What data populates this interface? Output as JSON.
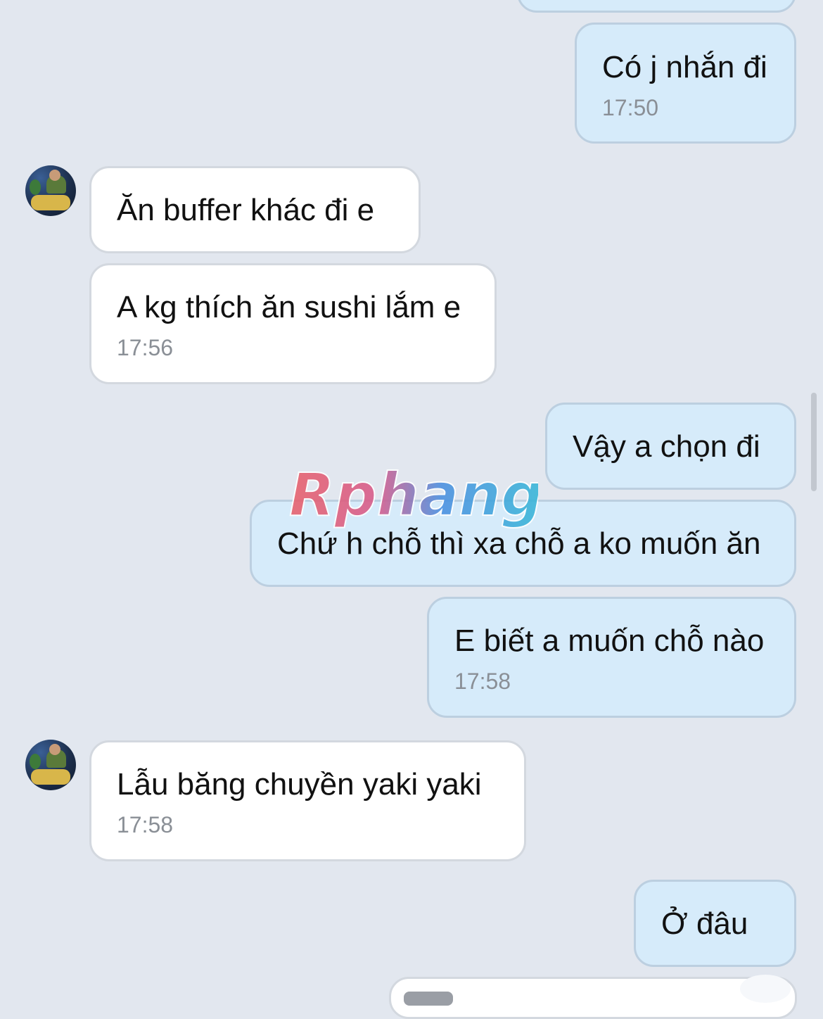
{
  "colors": {
    "background": "#e2e7ef",
    "outgoing_bubble": "#d6ebfa",
    "incoming_bubble": "#ffffff",
    "timestamp": "#8a8f96"
  },
  "messages": [
    {
      "direction": "outgoing",
      "text": "Có j nhắn đi",
      "time": "17:50"
    },
    {
      "direction": "incoming",
      "text": "Ăn buffer khác đi e",
      "time": ""
    },
    {
      "direction": "incoming",
      "text": "A kg thích ăn sushi lắm e",
      "time": "17:56"
    },
    {
      "direction": "outgoing",
      "text": "Vậy a chọn đi",
      "time": ""
    },
    {
      "direction": "outgoing",
      "text": "Chứ h chỗ thì xa chỗ a ko muốn ăn",
      "time": ""
    },
    {
      "direction": "outgoing",
      "text": "E biết a muốn chỗ nào",
      "time": "17:58"
    },
    {
      "direction": "incoming",
      "text": "Lẫu băng chuyền yaki yaki",
      "time": "17:58"
    },
    {
      "direction": "outgoing",
      "text": "Ở đâu",
      "time": ""
    }
  ],
  "watermark": {
    "text": "Rphang"
  }
}
